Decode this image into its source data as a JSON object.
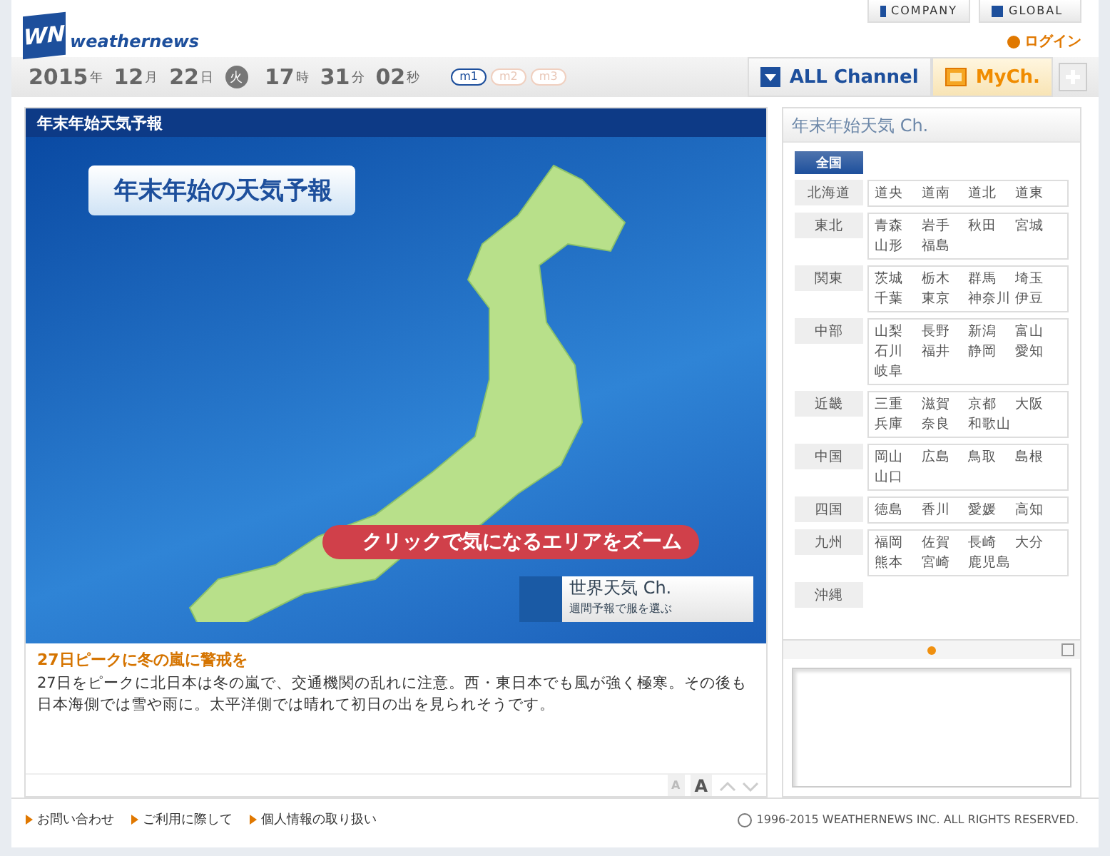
{
  "header": {
    "logo_mark": "WN",
    "logo_text": "weathernews",
    "links": [
      "COMPANY",
      "GLOBAL"
    ],
    "login": "ログイン"
  },
  "datebar": {
    "parts": [
      {
        "value": "2015",
        "unit": "年"
      },
      {
        "value": "12",
        "unit": "月"
      },
      {
        "value": "22",
        "unit": "日"
      }
    ],
    "weekday": "火",
    "time": [
      {
        "value": "17",
        "unit": "時"
      },
      {
        "value": "31",
        "unit": "分"
      },
      {
        "value": "02",
        "unit": "秒"
      }
    ],
    "modes": [
      {
        "label": "m1",
        "selected": true
      },
      {
        "label": "m2",
        "selected": false
      },
      {
        "label": "m3",
        "selected": false
      }
    ]
  },
  "tabs": [
    {
      "label": "ALL Channel",
      "kind": "all",
      "selected": false
    },
    {
      "label": "MyCh.",
      "kind": "my",
      "selected": true
    }
  ],
  "main": {
    "title": "年末年始天気予報",
    "banner": "年末年始の天気予報",
    "zoom_hint": "クリックで気になるエリアをズーム",
    "world": {
      "title": "世界天気 Ch.",
      "subtitle": "週間予報で服を選ぶ"
    },
    "headline": "27日ピークに冬の嵐に警戒を",
    "body": "27日をピークに北日本は冬の嵐で、交通機関の乱れに注意。西・東日本でも風が強く極寒。その後も日本海側では雪や雨に。太平洋側では晴れて初日の出を見られそうです。",
    "font_small": "A",
    "font_large": "A"
  },
  "side": {
    "title": "年末年始天気 Ch.",
    "national": {
      "label": "全国",
      "selected": true
    },
    "regions": [
      {
        "name": "北海道",
        "areas": [
          "道央",
          "道南",
          "道北",
          "道東"
        ]
      },
      {
        "name": "東北",
        "areas": [
          "青森",
          "岩手",
          "秋田",
          "宮城",
          "山形",
          "福島"
        ]
      },
      {
        "name": "関東",
        "areas": [
          "茨城",
          "栃木",
          "群馬",
          "埼玉",
          "千葉",
          "東京",
          "神奈川",
          "伊豆"
        ]
      },
      {
        "name": "中部",
        "areas": [
          "山梨",
          "長野",
          "新潟",
          "富山",
          "石川",
          "福井",
          "静岡",
          "愛知",
          "岐阜"
        ]
      },
      {
        "name": "近畿",
        "areas": [
          "三重",
          "滋賀",
          "京都",
          "大阪",
          "兵庫",
          "奈良",
          "和歌山"
        ]
      },
      {
        "name": "中国",
        "areas": [
          "岡山",
          "広島",
          "鳥取",
          "島根",
          "山口"
        ]
      },
      {
        "name": "四国",
        "areas": [
          "徳島",
          "香川",
          "愛媛",
          "高知"
        ]
      },
      {
        "name": "九州",
        "areas": [
          "福岡",
          "佐賀",
          "長崎",
          "大分",
          "熊本",
          "宮崎",
          "鹿児島"
        ]
      },
      {
        "name": "沖縄"
      }
    ]
  },
  "footer": {
    "links": [
      "お問い合わせ",
      "ご利用に際して",
      "個人情報の取り扱い"
    ],
    "copyright": "1996-2015 WEATHERNEWS INC. ALL RIGHTS RESERVED."
  }
}
